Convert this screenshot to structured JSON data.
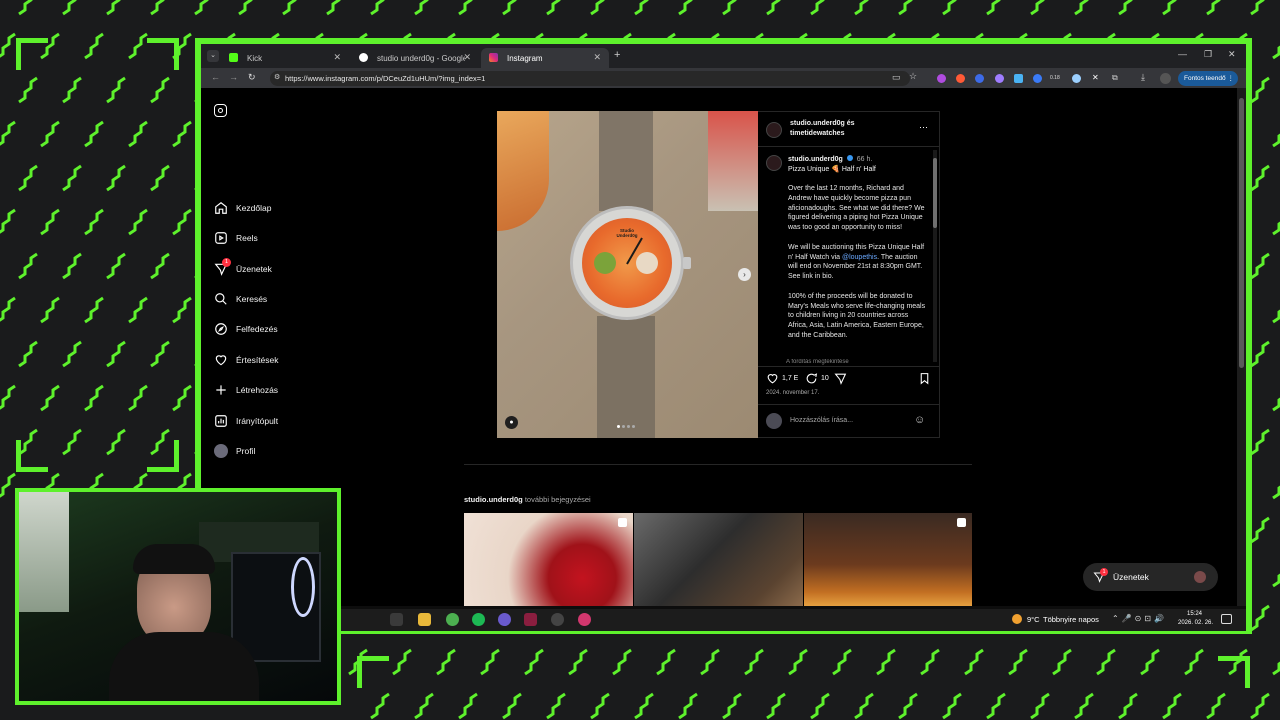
{
  "browser": {
    "tabs": [
      {
        "label": "Kick",
        "color": "#53fc18"
      },
      {
        "label": "studio underd0g - Google-kere",
        "color": "#4285f4"
      },
      {
        "label": "Instagram",
        "color": "#e1306c"
      }
    ],
    "url": "https://www.instagram.com/p/DCeuZd1uHUm/?img_index=1",
    "profile_button": "Fontos teendő",
    "ext_count": "0.18"
  },
  "sidebar": {
    "items": [
      {
        "label": "Kezdőlap",
        "icon": "home-icon"
      },
      {
        "label": "Reels",
        "icon": "reels-icon"
      },
      {
        "label": "Üzenetek",
        "icon": "messages-icon",
        "badge": "1"
      },
      {
        "label": "Keresés",
        "icon": "search-icon"
      },
      {
        "label": "Felfedezés",
        "icon": "explore-icon"
      },
      {
        "label": "Értesítések",
        "icon": "heart-icon"
      },
      {
        "label": "Létrehozás",
        "icon": "plus-icon"
      },
      {
        "label": "Irányítópult",
        "icon": "dashboard-icon"
      },
      {
        "label": "Profil",
        "icon": "avatar"
      }
    ]
  },
  "post": {
    "header_line1": "studio.underd0g és",
    "header_line2": "timetidewatches",
    "author": "studio.underd0g",
    "time": "66 h.",
    "title": "Pizza Unique 🍕 Half n' Half",
    "para1": "Over the last 12 months, Richard and Andrew have quickly become pizza pun aficionadoughs. See what we did there? We figured delivering a piping hot Pizza Unique was too good an opportunity to miss!",
    "para2_a": "We will be auctioning this Pizza Unique Half n' Half Watch via ",
    "para2_mention": "@loupethis",
    "para2_b": ". The auction will end on November 21st at 8:30pm GMT. See link in bio.",
    "para3": "100% of the proceeds will be donated to Mary's Meals who serve life-changing meals to children living in 20 countries across Africa, Asia, Latin America, Eastern Europe, and the Caribbean.",
    "more": "A fordítás megtekintése",
    "likes": "1,7 E",
    "comments": "10",
    "date": "2024. november 17.",
    "comment_placeholder": "Hozzászólás írása...",
    "dial_text": "Studio Underd0g"
  },
  "more_posts": {
    "author": "studio.underd0g",
    "label": " további bejegyzései"
  },
  "chat": {
    "label": "Üzenetek",
    "badge": "1"
  },
  "taskbar": {
    "weather_temp": "9°C",
    "weather_text": "Többnyire napos",
    "time": "15:24",
    "date": "2026. 02. 26."
  }
}
